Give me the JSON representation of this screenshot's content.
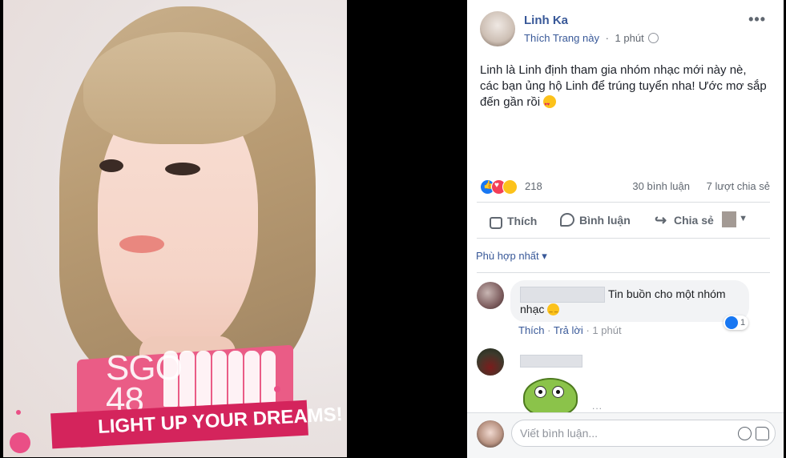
{
  "photo": {
    "frame_top_text": "SGO",
    "frame_number": "48",
    "frame_slogan": "LIGHT UP YOUR DREAMS!"
  },
  "post": {
    "author": "Linh Ka",
    "page_like": "Thích Trang này",
    "separator": "·",
    "time": "1 phút",
    "more": "•••",
    "text": "Linh là Linh định tham gia nhóm nhạc mới này nè, các bạn ủng hộ Linh để trúng tuyển nha! Ước mơ sắp đến gần rồi"
  },
  "stats": {
    "reactions_count": "218",
    "comments_count": "30 bình luận",
    "shares_count": "7 lượt chia sẻ"
  },
  "actions": {
    "like": "Thích",
    "comment": "Bình luận",
    "share": "Chia sẻ"
  },
  "sort": {
    "label": "Phù hợp nhất",
    "caret": "▾"
  },
  "comments": [
    {
      "text_line1": "Tin buồn cho một nhóm",
      "text_line2": "nhạc",
      "like_action": "Thích",
      "reply_action": "Trả lời",
      "separator": "·",
      "time": "1 phút",
      "likes": "1"
    },
    {
      "more": "..."
    }
  ],
  "composer": {
    "placeholder": "Viết bình luận..."
  },
  "colors": {
    "link": "#385898",
    "like_blue": "#1877f2",
    "love_red": "#f33e58",
    "frame_pink": "#d4245c"
  }
}
